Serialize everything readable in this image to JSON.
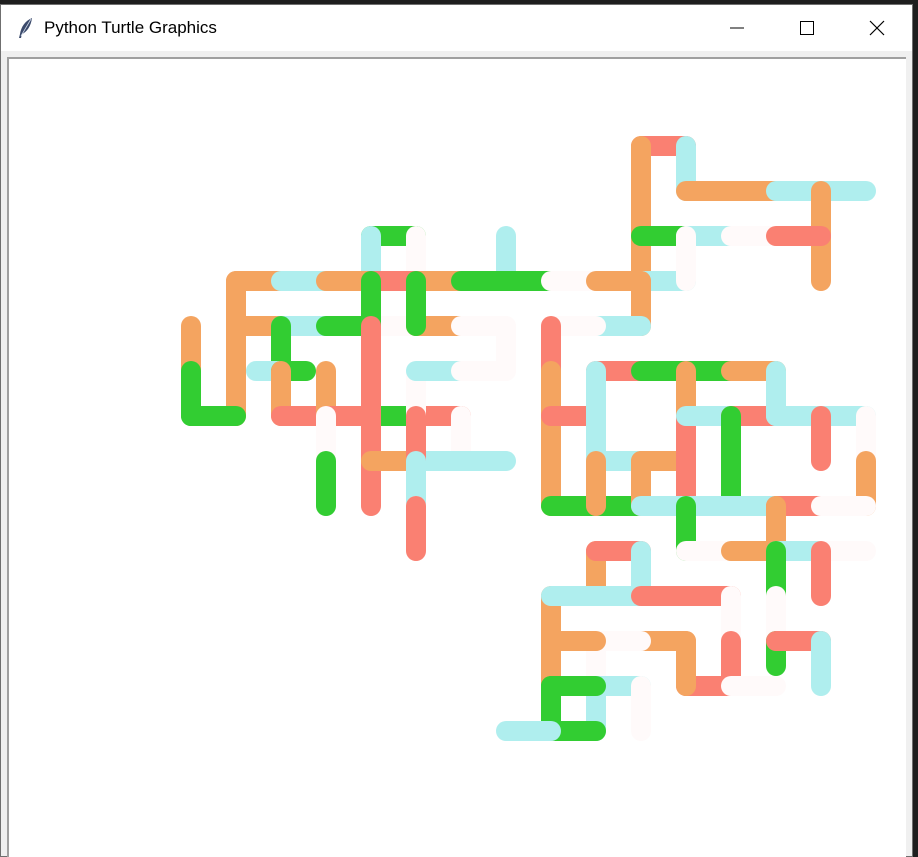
{
  "window": {
    "title": "Python Turtle Graphics",
    "icon": "feather-icon",
    "controls": [
      "minimize-icon",
      "maximize-icon",
      "close-icon"
    ]
  },
  "colors": {
    "salmon": "#fa8072",
    "sandybrown": "#f4a460",
    "limegreen": "#32cd32",
    "paleturquoise": "#afeeee",
    "snow": "#fffafa"
  },
  "drawing": {
    "pen_width": 20,
    "segments": [
      [
        "salmon",
        640,
        145,
        685,
        145
      ],
      [
        "paleturquoise",
        685,
        145,
        685,
        190
      ],
      [
        "sandybrown",
        685,
        190,
        775,
        190
      ],
      [
        "paleturquoise",
        775,
        190,
        865,
        190
      ],
      [
        "sandybrown",
        820,
        190,
        820,
        280
      ],
      [
        "sandybrown",
        640,
        145,
        640,
        280
      ],
      [
        "limegreen",
        640,
        235,
        685,
        235
      ],
      [
        "paleturquoise",
        685,
        235,
        730,
        235
      ],
      [
        "snow",
        730,
        235,
        775,
        235
      ],
      [
        "salmon",
        775,
        235,
        820,
        235
      ],
      [
        "paleturquoise",
        640,
        280,
        685,
        280
      ],
      [
        "snow",
        685,
        235,
        685,
        280
      ],
      [
        "limegreen",
        370,
        235,
        415,
        235
      ],
      [
        "paleturquoise",
        370,
        235,
        370,
        280
      ],
      [
        "snow",
        415,
        235,
        415,
        280
      ],
      [
        "paleturquoise",
        505,
        235,
        505,
        280
      ],
      [
        "sandybrown",
        415,
        280,
        460,
        280
      ],
      [
        "limegreen",
        460,
        280,
        550,
        280
      ],
      [
        "snow",
        550,
        280,
        595,
        280
      ],
      [
        "sandybrown",
        595,
        280,
        640,
        280
      ],
      [
        "sandybrown",
        640,
        280,
        640,
        325
      ],
      [
        "paleturquoise",
        595,
        325,
        640,
        325
      ],
      [
        "snow",
        550,
        325,
        595,
        325
      ],
      [
        "sandybrown",
        235,
        280,
        280,
        280
      ],
      [
        "paleturquoise",
        280,
        280,
        325,
        280
      ],
      [
        "sandybrown",
        325,
        280,
        370,
        280
      ],
      [
        "salmon",
        370,
        280,
        415,
        280
      ],
      [
        "sandybrown",
        235,
        280,
        235,
        415
      ],
      [
        "sandybrown",
        235,
        325,
        280,
        325
      ],
      [
        "paleturquoise",
        280,
        325,
        325,
        325
      ],
      [
        "limegreen",
        325,
        325,
        370,
        325
      ],
      [
        "snow",
        370,
        325,
        415,
        325
      ],
      [
        "sandybrown",
        415,
        325,
        460,
        325
      ],
      [
        "snow",
        460,
        325,
        505,
        325
      ],
      [
        "snow",
        505,
        325,
        505,
        370
      ],
      [
        "limegreen",
        370,
        280,
        370,
        325
      ],
      [
        "limegreen",
        415,
        280,
        415,
        325
      ],
      [
        "sandybrown",
        190,
        325,
        190,
        370
      ],
      [
        "limegreen",
        190,
        370,
        190,
        415
      ],
      [
        "limegreen",
        190,
        415,
        235,
        415
      ],
      [
        "limegreen",
        280,
        325,
        280,
        370
      ],
      [
        "paleturquoise",
        255,
        370,
        280,
        370
      ],
      [
        "limegreen",
        280,
        370,
        305,
        370
      ],
      [
        "sandybrown",
        280,
        370,
        280,
        415
      ],
      [
        "salmon",
        280,
        415,
        325,
        415
      ],
      [
        "sandybrown",
        325,
        370,
        325,
        415
      ],
      [
        "salmon",
        325,
        415,
        370,
        415
      ],
      [
        "limegreen",
        370,
        415,
        415,
        415
      ],
      [
        "salmon",
        415,
        415,
        460,
        415
      ],
      [
        "snow",
        460,
        415,
        460,
        460
      ],
      [
        "salmon",
        370,
        325,
        370,
        505
      ],
      [
        "snow",
        325,
        415,
        325,
        460
      ],
      [
        "limegreen",
        325,
        460,
        325,
        505
      ],
      [
        "sandybrown",
        370,
        460,
        415,
        460
      ],
      [
        "paleturquoise",
        415,
        460,
        505,
        460
      ],
      [
        "snow",
        415,
        370,
        415,
        415
      ],
      [
        "salmon",
        415,
        415,
        415,
        460
      ],
      [
        "paleturquoise",
        415,
        460,
        415,
        505
      ],
      [
        "snow",
        415,
        505,
        415,
        505
      ],
      [
        "salmon",
        415,
        505,
        415,
        550
      ],
      [
        "paleturquoise",
        415,
        370,
        460,
        370
      ],
      [
        "snow",
        460,
        370,
        505,
        370
      ],
      [
        "salmon",
        550,
        325,
        550,
        370
      ],
      [
        "sandybrown",
        550,
        370,
        550,
        505
      ],
      [
        "salmon",
        550,
        415,
        595,
        415
      ],
      [
        "limegreen",
        550,
        505,
        640,
        505
      ],
      [
        "salmon",
        595,
        370,
        640,
        370
      ],
      [
        "limegreen",
        640,
        370,
        730,
        370
      ],
      [
        "sandybrown",
        730,
        370,
        775,
        370
      ],
      [
        "paleturquoise",
        595,
        370,
        595,
        460
      ],
      [
        "paleturquoise",
        595,
        460,
        640,
        460
      ],
      [
        "sandybrown",
        595,
        460,
        595,
        505
      ],
      [
        "sandybrown",
        640,
        460,
        685,
        460
      ],
      [
        "sandybrown",
        640,
        460,
        640,
        505
      ],
      [
        "sandybrown",
        685,
        370,
        685,
        415
      ],
      [
        "salmon",
        685,
        415,
        685,
        505
      ],
      [
        "paleturquoise",
        685,
        415,
        730,
        415
      ],
      [
        "salmon",
        730,
        415,
        775,
        415
      ],
      [
        "paleturquoise",
        775,
        370,
        775,
        415
      ],
      [
        "paleturquoise",
        775,
        415,
        865,
        415
      ],
      [
        "snow",
        865,
        415,
        865,
        460
      ],
      [
        "sandybrown",
        865,
        460,
        865,
        505
      ],
      [
        "limegreen",
        730,
        415,
        730,
        505
      ],
      [
        "paleturquoise",
        640,
        505,
        730,
        505
      ],
      [
        "paleturquoise",
        730,
        505,
        775,
        505
      ],
      [
        "salmon",
        775,
        505,
        820,
        505
      ],
      [
        "snow",
        820,
        505,
        865,
        505
      ],
      [
        "salmon",
        820,
        415,
        820,
        460
      ],
      [
        "limegreen",
        685,
        505,
        685,
        550
      ],
      [
        "snow",
        685,
        550,
        730,
        550
      ],
      [
        "sandybrown",
        730,
        550,
        775,
        550
      ],
      [
        "sandybrown",
        775,
        505,
        775,
        550
      ],
      [
        "paleturquoise",
        775,
        550,
        820,
        550
      ],
      [
        "snow",
        820,
        550,
        865,
        550
      ],
      [
        "salmon",
        820,
        550,
        820,
        595
      ],
      [
        "limegreen",
        775,
        550,
        775,
        595
      ],
      [
        "snow",
        775,
        595,
        775,
        640
      ],
      [
        "limegreen",
        775,
        640,
        775,
        665
      ],
      [
        "salmon",
        775,
        640,
        820,
        640
      ],
      [
        "paleturquoise",
        820,
        640,
        820,
        685
      ],
      [
        "sandybrown",
        595,
        550,
        595,
        595
      ],
      [
        "salmon",
        595,
        550,
        640,
        550
      ],
      [
        "paleturquoise",
        640,
        550,
        640,
        595
      ],
      [
        "paleturquoise",
        595,
        595,
        640,
        595
      ],
      [
        "salmon",
        640,
        595,
        730,
        595
      ],
      [
        "snow",
        730,
        595,
        730,
        640
      ],
      [
        "salmon",
        730,
        640,
        730,
        685
      ],
      [
        "salmon",
        685,
        685,
        730,
        685
      ],
      [
        "snow",
        730,
        685,
        775,
        685
      ],
      [
        "sandybrown",
        685,
        640,
        685,
        685
      ],
      [
        "sandybrown",
        640,
        640,
        685,
        640
      ],
      [
        "snow",
        595,
        640,
        640,
        640
      ],
      [
        "snow",
        595,
        640,
        595,
        685
      ],
      [
        "paleturquoise",
        595,
        685,
        640,
        685
      ],
      [
        "snow",
        640,
        685,
        640,
        730
      ],
      [
        "paleturquoise",
        595,
        685,
        595,
        730
      ],
      [
        "sandybrown",
        550,
        595,
        550,
        685
      ],
      [
        "paleturquoise",
        550,
        595,
        595,
        595
      ],
      [
        "sandybrown",
        550,
        640,
        595,
        640
      ],
      [
        "limegreen",
        550,
        685,
        595,
        685
      ],
      [
        "limegreen",
        550,
        685,
        550,
        730
      ],
      [
        "limegreen",
        550,
        730,
        595,
        730
      ],
      [
        "paleturquoise",
        505,
        730,
        550,
        730
      ]
    ]
  }
}
